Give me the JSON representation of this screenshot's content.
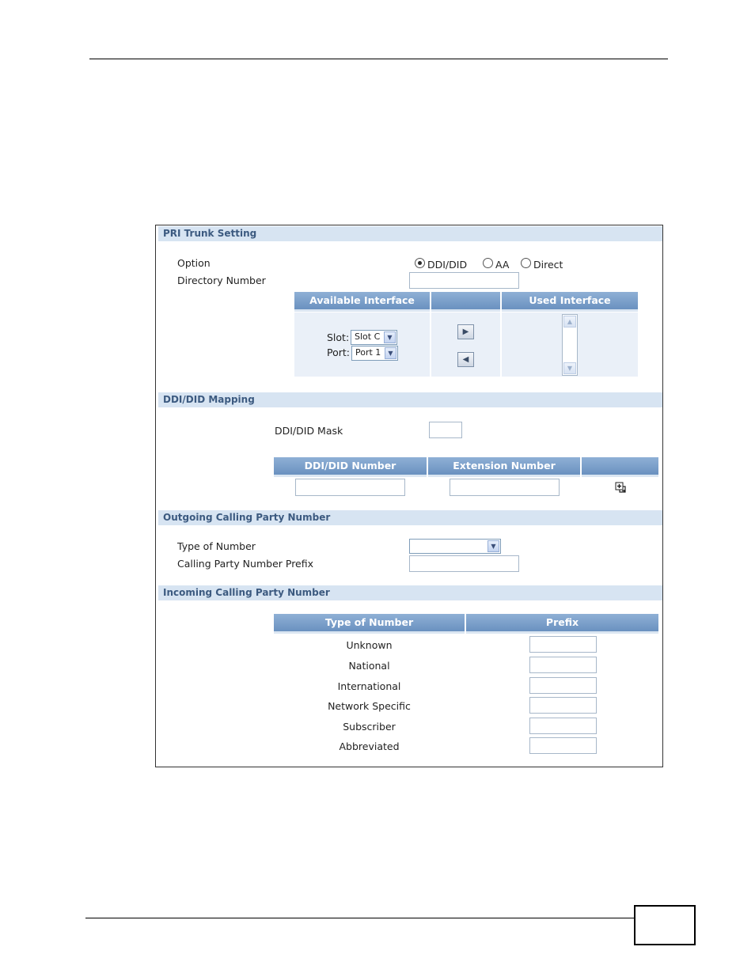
{
  "pri_trunk": {
    "title": "PRI Trunk Setting",
    "option_label": "Option",
    "options": [
      "DDI/DID",
      "AA",
      "Direct"
    ],
    "selected_option": "DDI/DID",
    "directory_label": "Directory Number",
    "directory_value": "",
    "available_header": "Available Interface",
    "used_header": "Used Interface",
    "slot_label": "Slot:",
    "slot_value": "Slot C",
    "port_label": "Port:",
    "port_value": "Port 1",
    "move_right_glyph": "▶",
    "move_left_glyph": "◀"
  },
  "ddi_mapping": {
    "title": "DDI/DID Mapping",
    "mask_label": "DDI/DID Mask",
    "mask_value": "",
    "col_ddi": "DDI/DID Number",
    "col_ext": "Extension Number",
    "ddi_value": "",
    "ext_value": ""
  },
  "outgoing": {
    "title": "Outgoing Calling Party Number",
    "type_label": "Type of Number",
    "type_value": "",
    "prefix_label": "Calling Party Number Prefix",
    "prefix_value": ""
  },
  "incoming": {
    "title": "Incoming Calling Party Number",
    "col_type": "Type of Number",
    "col_prefix": "Prefix",
    "rows": [
      {
        "type": "Unknown",
        "prefix": ""
      },
      {
        "type": "National",
        "prefix": ""
      },
      {
        "type": "International",
        "prefix": ""
      },
      {
        "type": "Network Specific",
        "prefix": ""
      },
      {
        "type": "Subscriber",
        "prefix": ""
      },
      {
        "type": "Abbreviated",
        "prefix": ""
      }
    ]
  },
  "icons": {
    "add": "add-entry-icon",
    "dropdown": "chevron-down-icon",
    "scroll_up": "scroll-up-icon",
    "scroll_down": "scroll-down-icon"
  },
  "colors": {
    "section_bg": "#d7e4f2",
    "section_text": "#3c5a80",
    "header_bg": "#7aa0cc"
  }
}
